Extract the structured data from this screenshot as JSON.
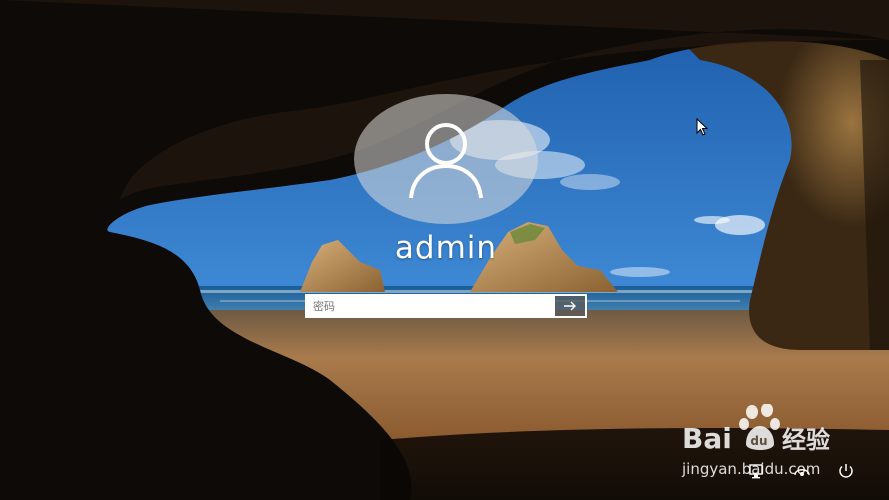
{
  "user": {
    "name": "admin"
  },
  "login": {
    "password_placeholder": "密码",
    "submit_icon": "arrow-right-icon"
  },
  "bottom_bar": {
    "icons": [
      "network-icon",
      "ease-of-access-icon",
      "power-icon"
    ]
  },
  "watermark": {
    "brand": "Baidu经验",
    "url": "jingyan.baidu.com"
  },
  "colors": {
    "sky": "#2a6fc0",
    "sand": "#b07844",
    "sea": "#1e5fa3",
    "rock": "#b88a4c",
    "cave": "#0e0b08"
  }
}
